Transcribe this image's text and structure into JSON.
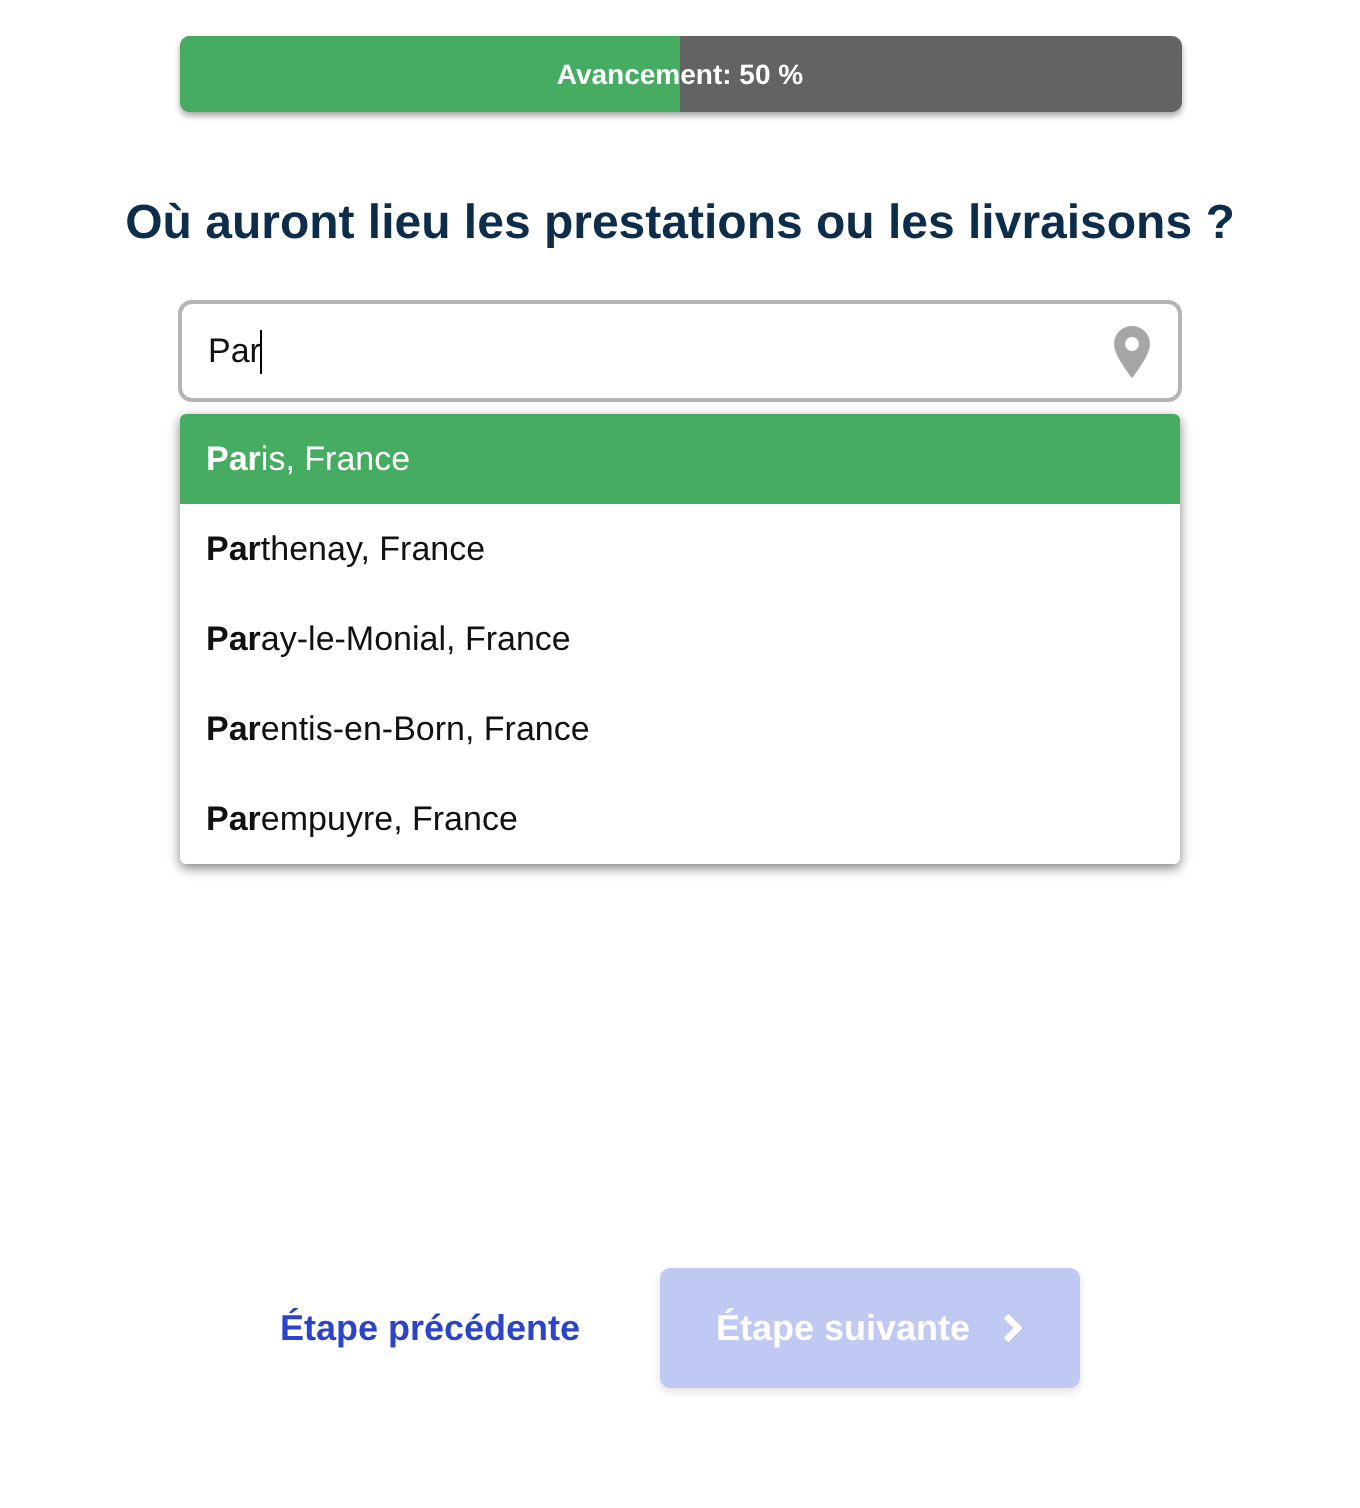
{
  "progress": {
    "label": "Avancement: 50 %",
    "level": 0.5
  },
  "question": "Où auront lieu les prestations ou les livraisons ?",
  "location_field": {
    "value": "Par"
  },
  "suggestions": [
    {
      "label": "**Par**is, France",
      "selected": true
    },
    {
      "label": "**Par**thenay, France",
      "selected": false
    },
    {
      "label": "**Par**ay-le-Monial, France",
      "selected": false
    },
    {
      "label": "**Par**entis-en-Born, France",
      "selected": false
    },
    {
      "label": "**Par**empuyre, France",
      "selected": false
    }
  ],
  "previous_button": "Étape précédente",
  "next_button": {
    "label": "Étape suivante",
    "disabled": true
  }
}
